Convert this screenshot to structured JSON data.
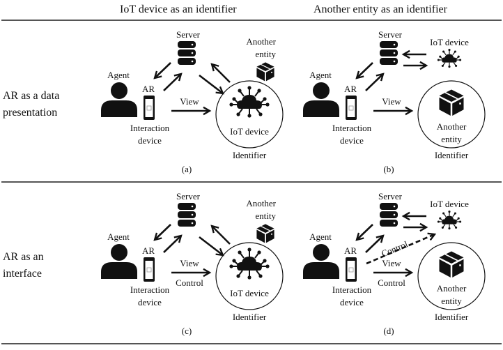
{
  "column_headers": [
    "IoT device as an identifier",
    "Another entity as an identifier"
  ],
  "row_headers": [
    {
      "line1": "AR as a data",
      "line2": "presentation"
    },
    {
      "line1": "AR as an",
      "line2": "interface"
    }
  ],
  "labels": {
    "server": "Server",
    "agent": "Agent",
    "ar": "AR",
    "interaction_line1": "Interaction",
    "interaction_line2": "device",
    "view": "View",
    "control": "Control",
    "iot_device": "IoT device",
    "another_line1": "Another",
    "another_line2": "entity",
    "identifier": "Identifier"
  },
  "panels": [
    {
      "id": "a",
      "caption": "(a)",
      "identifier": "iot",
      "mode": "view"
    },
    {
      "id": "b",
      "caption": "(b)",
      "identifier": "entity",
      "mode": "view"
    },
    {
      "id": "c",
      "caption": "(c)",
      "identifier": "iot",
      "mode": "control"
    },
    {
      "id": "d",
      "caption": "(d)",
      "identifier": "entity",
      "mode": "control"
    }
  ]
}
